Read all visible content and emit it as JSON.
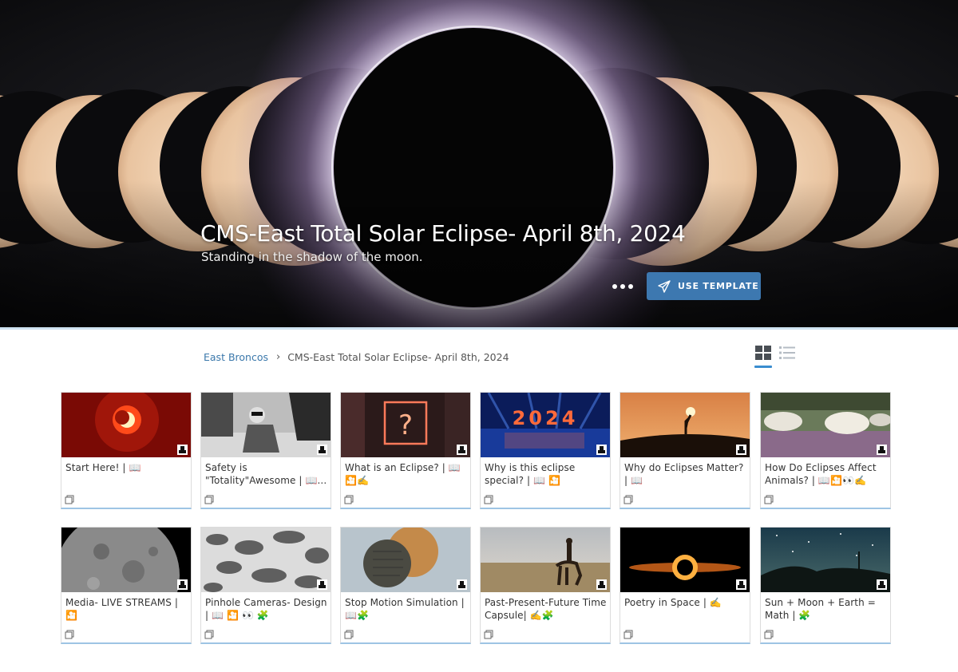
{
  "hero": {
    "title": "CMS-East Total Solar Eclipse- April 8th, 2024",
    "subtitle": "Standing in the shadow of the moon.",
    "use_template_label": "USE TEMPLATE"
  },
  "breadcrumb": {
    "parent": "East Broncos",
    "separator": "›",
    "current": "CMS-East Total Solar Eclipse- April 8th, 2024"
  },
  "colors": {
    "accent": "#3d78b0",
    "link": "#3b78ab",
    "active_view": "#3a8dcf"
  },
  "cards": [
    {
      "title": "Start Here! | 📖",
      "thumb": "red-sun"
    },
    {
      "title": "Safety is \"Totality\"Awesome | 📖...",
      "thumb": "bw-person"
    },
    {
      "title": "What is an Eclipse? | 📖 🎦✍️",
      "thumb": "neon-question"
    },
    {
      "title": "Why is this eclipse special? | 📖 🎦",
      "thumb": "2024-neon"
    },
    {
      "title": "Why do Eclipses Matter? | 📖",
      "thumb": "sunset-silhouette"
    },
    {
      "title": "How Do Eclipses Affect Animals? | 📖🎦👀✍️",
      "thumb": "cows"
    },
    {
      "title": "Media-  LIVE STREAMS | 🎦",
      "thumb": "moon"
    },
    {
      "title": "Pinhole Cameras- Design | 📖 🎦 👀 🧩",
      "thumb": "pinhole-shadows"
    },
    {
      "title": "Stop Motion Simulation | 📖🧩",
      "thumb": "cookie-eclipse"
    },
    {
      "title": "Past-Present-Future Time Capsule| ✍️🧩",
      "thumb": "horse-rider"
    },
    {
      "title": "Poetry in Space | ✍️",
      "thumb": "black-hole"
    },
    {
      "title": "Sun + Moon + Earth = Math | 🧩",
      "thumb": "night-sky"
    }
  ]
}
